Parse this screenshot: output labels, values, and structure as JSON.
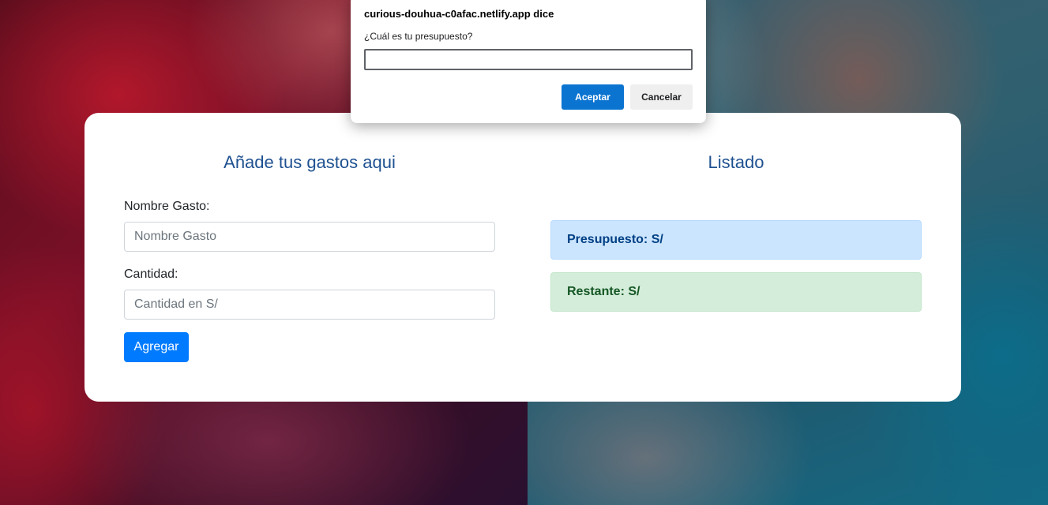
{
  "left_column": {
    "title": "Añade tus gastos aqui",
    "name_label": "Nombre Gasto:",
    "name_placeholder": "Nombre Gasto",
    "name_value": "",
    "amount_label": "Cantidad:",
    "amount_placeholder": "Cantidad en S/",
    "amount_value": "",
    "add_button": "Agregar"
  },
  "right_column": {
    "title": "Listado",
    "budget": "Presupuesto: S/",
    "remaining": "Restante: S/"
  },
  "prompt_dialog": {
    "origin": "curious-douhua-c0afac.netlify.app dice",
    "message": "¿Cuál es tu presupuesto?",
    "input_value": "",
    "ok_label": "Aceptar",
    "cancel_label": "Cancelar"
  },
  "colors": {
    "primary": "#007bff",
    "title": "#1f5191",
    "budget_alert_bg": "#cce5ff",
    "remaining_alert_bg": "#d4edda",
    "dialog_ok": "#0b74d1"
  }
}
